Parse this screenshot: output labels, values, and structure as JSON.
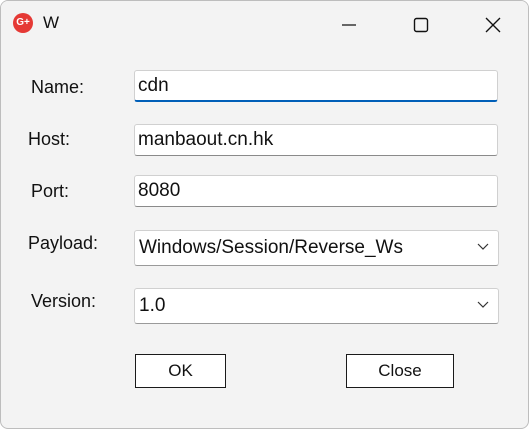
{
  "window": {
    "title": "W",
    "icon": "app-red-circle-icon",
    "controls": [
      "minimize-icon",
      "maximize-icon",
      "close-icon"
    ]
  },
  "form": {
    "name_label": "Name:",
    "name_value": "cdn",
    "host_label": "Host:",
    "host_value": "manbaout.cn.hk",
    "port_label": "Port:",
    "port_value": "8080",
    "payload_label": "Payload:",
    "payload_value": "Windows/Session/Reverse_Ws",
    "version_label": "Version:",
    "version_value": "1.0"
  },
  "buttons": {
    "ok_label": "OK",
    "close_label": "Close"
  },
  "colors": {
    "focus_accent": "#005fb8",
    "app_icon": "#e53935"
  }
}
